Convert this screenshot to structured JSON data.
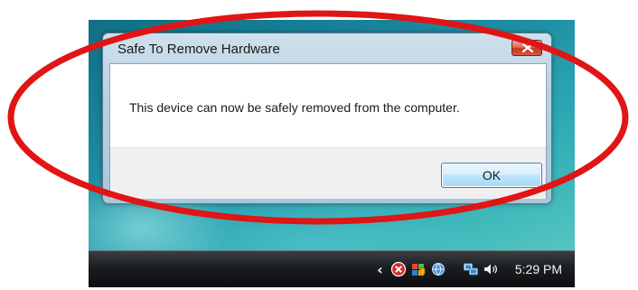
{
  "dialog": {
    "title": "Safe To Remove Hardware",
    "message": "This device can now be safely removed from the computer.",
    "ok_label": "OK",
    "close_icon": "close-icon"
  },
  "taskbar": {
    "tray_icons": [
      "expand-tray-chevron-icon",
      "safely-remove-error-icon",
      "security-shield-icon",
      "network-globe-icon",
      "network-connection-icon",
      "volume-icon"
    ],
    "clock": "5:29 PM"
  },
  "colors": {
    "annotation_ring": "#e01515",
    "close_button": "#c8452b",
    "ok_button_border": "#3c7fb1",
    "desktop": "#1b8aa2",
    "taskbar": "#1b1e21"
  }
}
